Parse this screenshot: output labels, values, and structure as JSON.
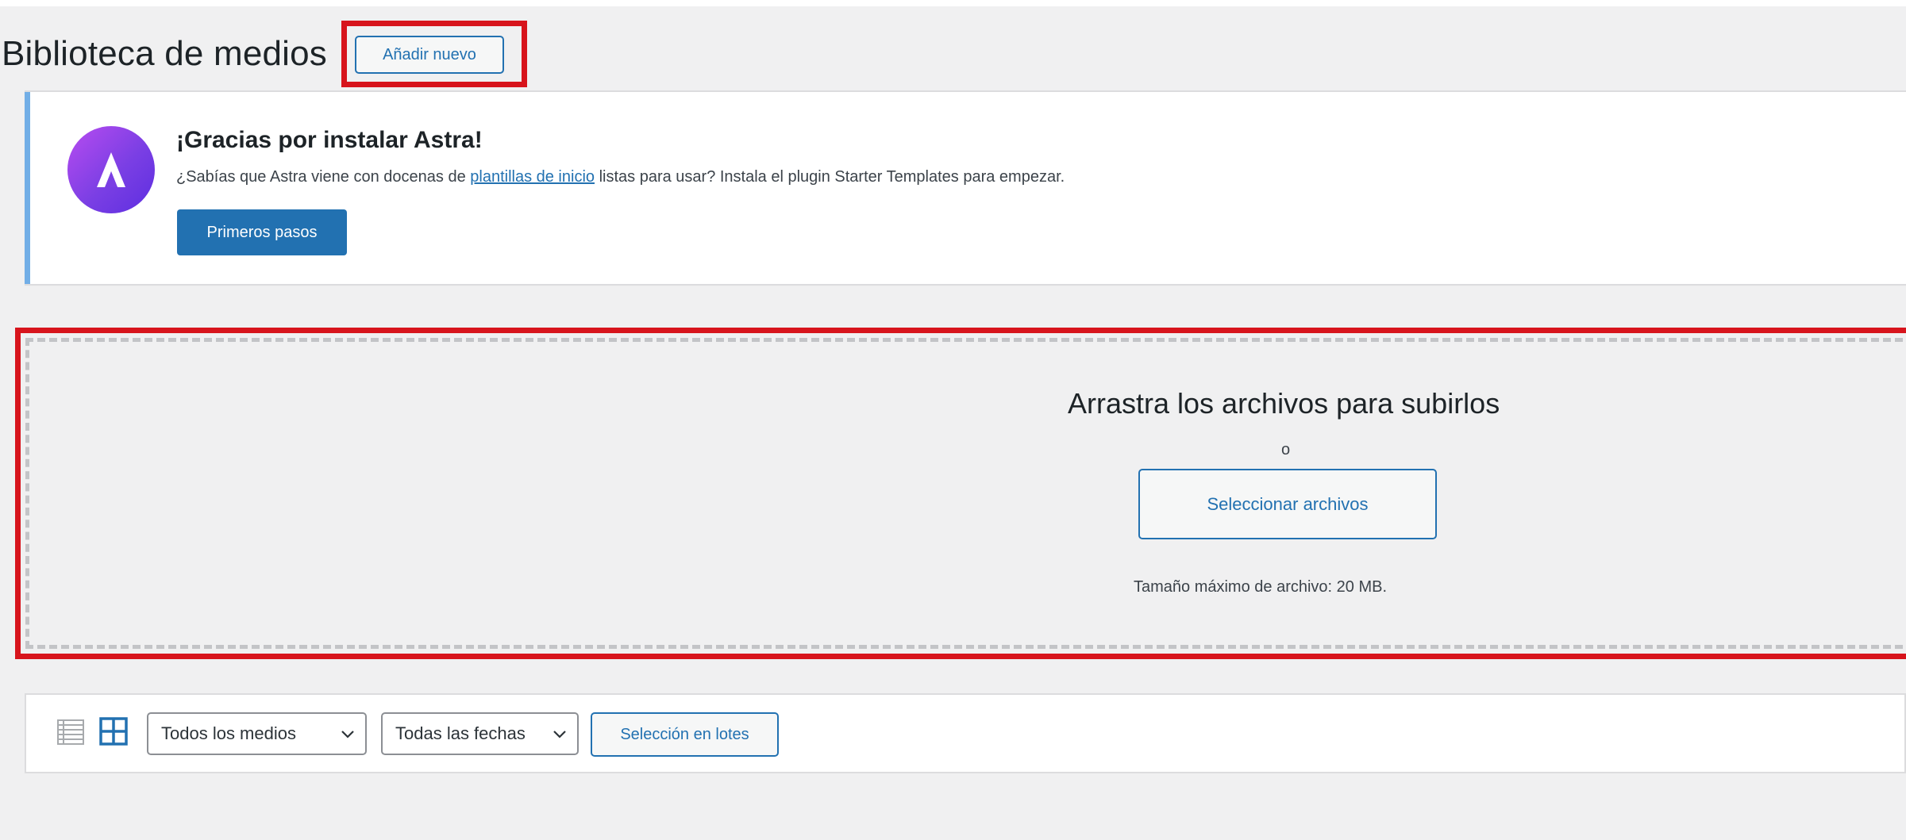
{
  "header": {
    "title": "Biblioteca de medios",
    "add_new_label": "Añadir nuevo"
  },
  "notice": {
    "title": "¡Gracias por instalar Astra!",
    "text_before": "¿Sabías que Astra viene con docenas de ",
    "link_text": "plantillas de inicio",
    "text_after": " listas para usar? Instala el plugin Starter Templates para empezar.",
    "button_label": "Primeros pasos",
    "logo_icon": "astra-logo-icon"
  },
  "upload": {
    "title": "Arrastra los archivos para subirlos",
    "or": "o",
    "select_label": "Seleccionar archivos",
    "max_size": "Tamaño máximo de archivo: 20 MB."
  },
  "toolbar": {
    "list_view_icon": "list-view-icon",
    "grid_view_icon": "grid-view-icon",
    "filter_media": "Todos los medios",
    "filter_dates": "Todas las fechas",
    "bulk_select_label": "Selección en lotes"
  },
  "colors": {
    "highlight": "#d7141c",
    "primary": "#2271b1",
    "notice_border": "#72aee6",
    "page_bg": "#f0f0f1"
  }
}
